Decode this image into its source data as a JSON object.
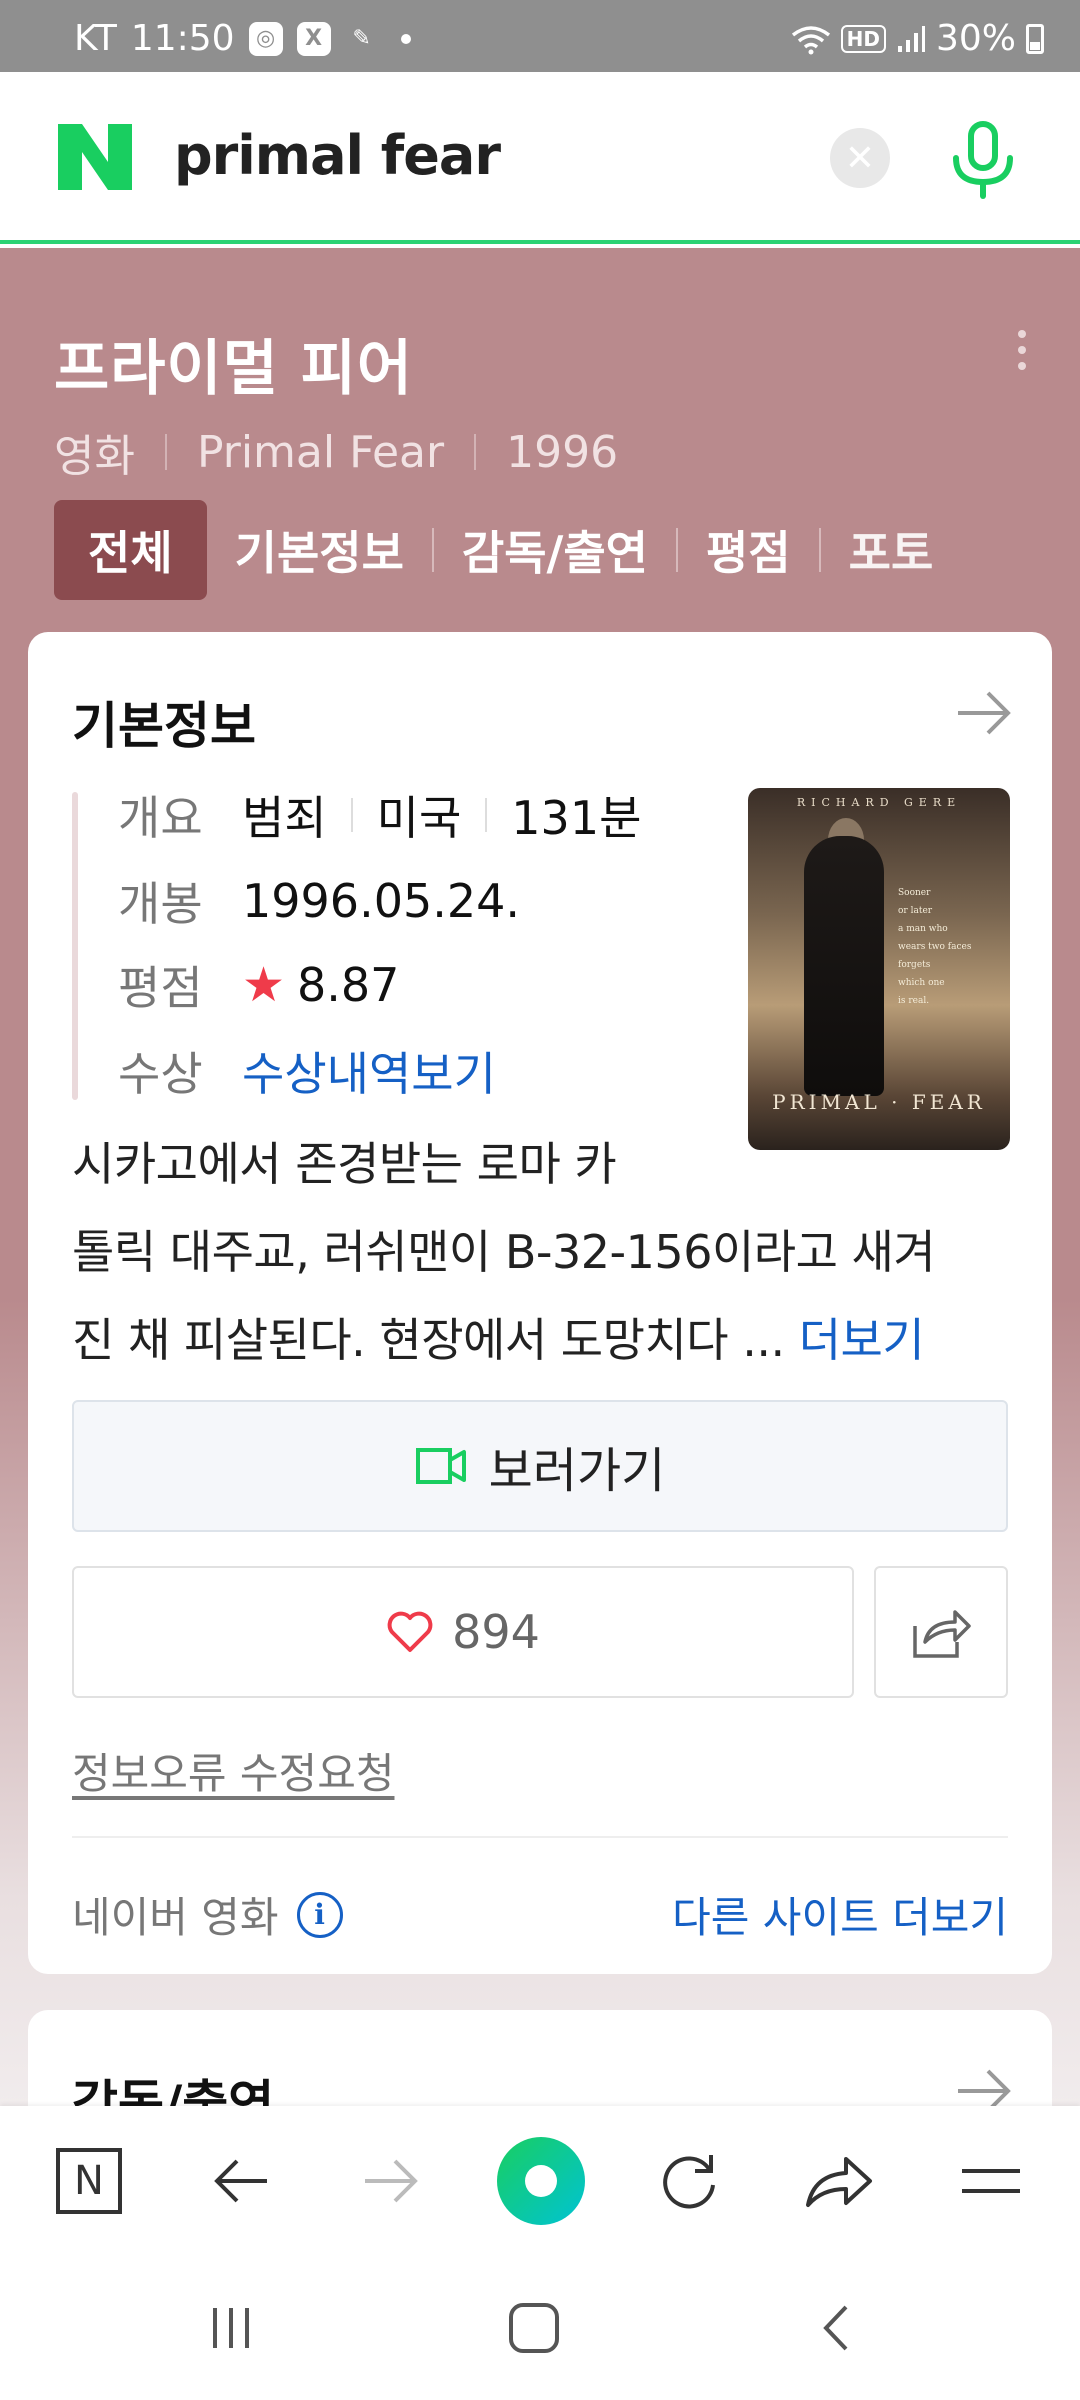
{
  "status_bar": {
    "carrier": "KT",
    "time": "11:50",
    "battery": "30%",
    "icons": [
      "compass-icon",
      "x-icon",
      "feather-icon",
      "wifi-icon",
      "hd-icon",
      "signal-icon",
      "battery-icon"
    ]
  },
  "search": {
    "logo": "N",
    "query": "primal fear"
  },
  "movie": {
    "title": "프라이멀 피어",
    "meta": [
      "영화",
      "Primal Fear",
      "1996"
    ]
  },
  "tabs": [
    {
      "label": "전체",
      "active": true
    },
    {
      "label": "기본정보",
      "active": false
    },
    {
      "label": "감독/출연",
      "active": false
    },
    {
      "label": "평점",
      "active": false
    },
    {
      "label": "포토",
      "active": false
    }
  ],
  "basic_info": {
    "section_title": "기본정보",
    "overview_label": "개요",
    "overview_values": [
      "범죄",
      "미국",
      "131분"
    ],
    "release_label": "개봉",
    "release_value": "1996.05.24.",
    "rating_label": "평점",
    "rating_value": "8.87",
    "award_label": "수상",
    "award_link": "수상내역보기",
    "poster": {
      "top_text": "RICHARD GERE",
      "tagline": [
        "Sooner",
        "or later",
        "a man who",
        "wears two faces",
        "forgets",
        "which one",
        "is real."
      ],
      "bottom_text": "PRIMAL · FEAR"
    },
    "synopsis_line1": "시카고에서 존경받는 로마 카",
    "synopsis_line2": "톨릭 대주교, 러쉬맨이 B-32-156이라고 새겨",
    "synopsis_line3": "진 채 피살된다. 현장에서 도망치다 ... ",
    "more_label": "더보기",
    "watch_label": "보러가기",
    "like_count": "894",
    "error_report": "정보오류 수정요청",
    "source": "네이버 영화",
    "other_sites": "다른 사이트 더보기"
  },
  "cast_section": {
    "title": "감독/출연"
  },
  "colors": {
    "header_bg": "#b98a8d",
    "active_tab": "#8b4b4f",
    "naver_green": "#19ce60",
    "link_blue": "#1560c5",
    "star_red": "#ef3b4a"
  }
}
